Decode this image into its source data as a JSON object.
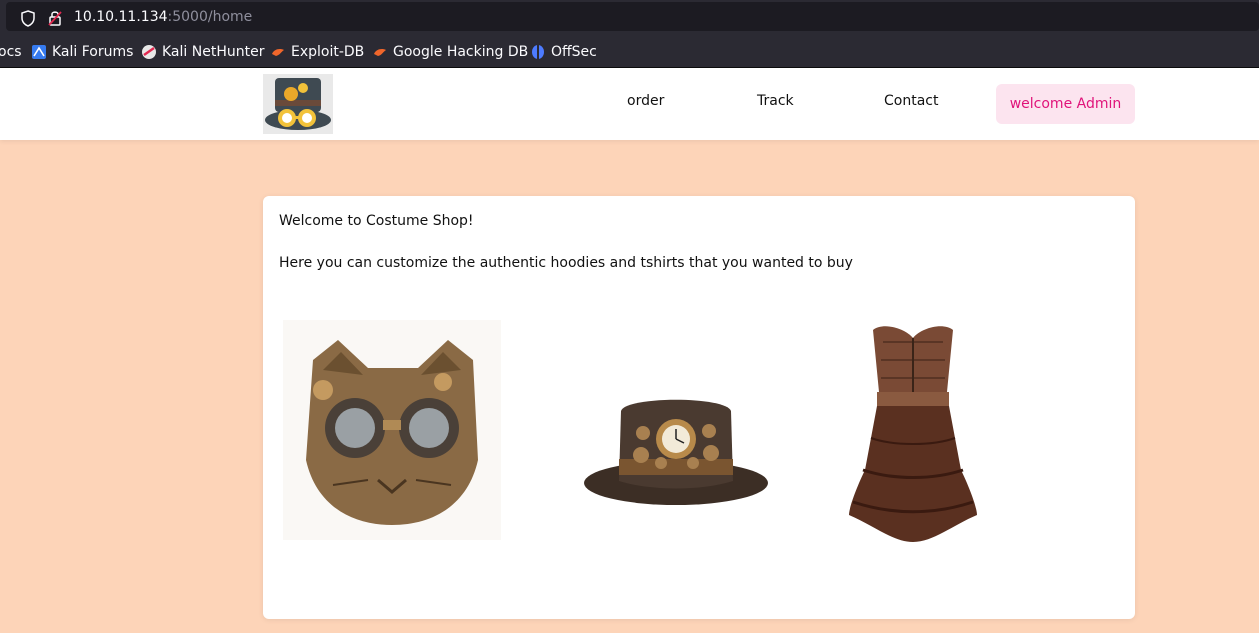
{
  "browser": {
    "url_host": "10.10.11.134",
    "url_path": ":5000/home",
    "bookmarks": [
      {
        "label": "ocs",
        "icon": "none"
      },
      {
        "label": "Kali Forums",
        "icon": "kali-forums-icon"
      },
      {
        "label": "Kali NetHunter",
        "icon": "kali-nethunter-icon"
      },
      {
        "label": "Exploit-DB",
        "icon": "exploit-db-icon"
      },
      {
        "label": "Google Hacking DB",
        "icon": "exploit-db-icon"
      },
      {
        "label": "OffSec",
        "icon": "offsec-icon"
      }
    ]
  },
  "site": {
    "nav": {
      "order": "order",
      "track": "Track",
      "contact": "Contact",
      "welcome": "welcome Admin"
    },
    "card": {
      "title": "Welcome to Costume Shop!",
      "text": "Here you can customize the authentic hoodies and tshirts that you wanted to buy"
    },
    "products": [
      {
        "name": "steampunk-cat-mask",
        "icon": "cat-mask-image"
      },
      {
        "name": "steampunk-top-hat",
        "icon": "top-hat-image"
      },
      {
        "name": "steampunk-corset-dress",
        "icon": "corset-dress-image"
      }
    ]
  },
  "colors": {
    "page_bg": "#fdd4b8",
    "accent_pink": "#e0137a",
    "welcome_bg": "#fce4ef"
  }
}
